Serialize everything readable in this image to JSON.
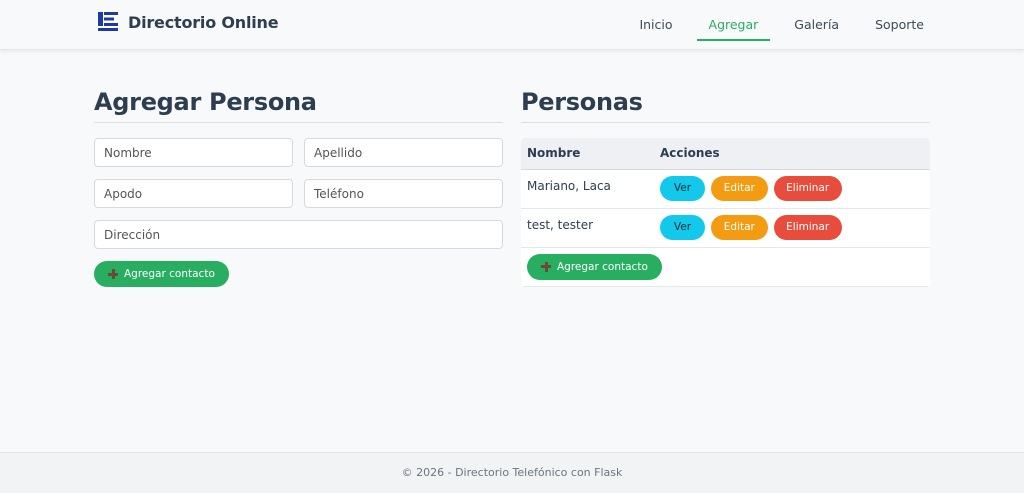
{
  "header": {
    "brand": "Directorio Online",
    "logo_icon": "directory-logo-icon",
    "nav": [
      {
        "label": "Inicio",
        "active": false
      },
      {
        "label": "Agregar",
        "active": true
      },
      {
        "label": "Galería",
        "active": false
      },
      {
        "label": "Soporte",
        "active": false
      }
    ],
    "accent_color": "#27ae60"
  },
  "form": {
    "title": "Agregar Persona",
    "fields": {
      "nombre": {
        "placeholder": "Nombre",
        "value": ""
      },
      "apellido": {
        "placeholder": "Apellido",
        "value": ""
      },
      "apodo": {
        "placeholder": "Apodo",
        "value": ""
      },
      "telefono": {
        "placeholder": "Teléfono",
        "value": ""
      },
      "direccion": {
        "placeholder": "Dirección",
        "value": ""
      }
    },
    "submit_label": "Agregar contacto"
  },
  "list": {
    "title": "Personas",
    "columns": [
      "Nombre",
      "Acciones"
    ],
    "rows": [
      {
        "name": "Mariano, Laca"
      },
      {
        "name": "test, tester"
      }
    ],
    "actions": {
      "view": "Ver",
      "edit": "Editar",
      "delete": "Eliminar"
    },
    "add_label": "Agregar contacto"
  },
  "footer": {
    "text": "© 2026 - Directorio Telefónico con Flask"
  }
}
